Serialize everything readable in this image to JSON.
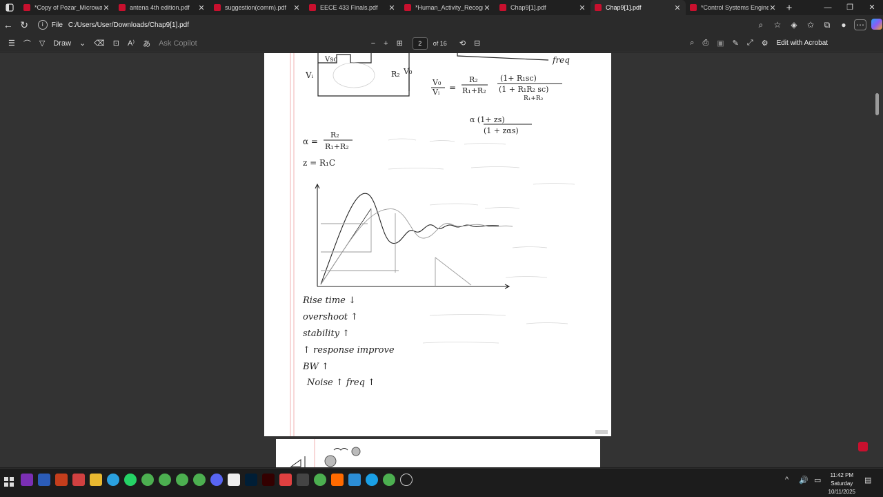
{
  "browser": {
    "tabs": [
      {
        "title": "*Copy of Pozar_Microwave",
        "active": false
      },
      {
        "title": "antena 4th edition.pdf",
        "active": false
      },
      {
        "title": "suggestion(comm).pdf",
        "active": false
      },
      {
        "title": "EECE 433 Finals.pdf",
        "active": false
      },
      {
        "title": "*Human_Activity_Recogniti",
        "active": false
      },
      {
        "title": "Chap9[1].pdf",
        "active": false
      },
      {
        "title": "Chap9[1].pdf",
        "active": true
      },
      {
        "title": "*Control Systems Engineeri",
        "active": false
      }
    ],
    "address": {
      "label": "File",
      "url": "C:/Users/User/Downloads/Chap9[1].pdf"
    }
  },
  "pdf_toolbar": {
    "draw_label": "Draw",
    "ask_copilot": "Ask Copilot",
    "page_current": "2",
    "page_total": "of 16",
    "edit_acrobat": "Edit with Acrobat"
  },
  "notes": {
    "vi": "Vᵢ",
    "vo": "V₀",
    "r2": "R₂",
    "c_box": "Vsc",
    "tf_lhs_num": "V₀",
    "tf_lhs_den": "Vᵢ",
    "tf_eq": "=",
    "tf_r_num": "R₂",
    "tf_r_den": "R₁+R₂",
    "tf_big_num": "(1+ R₁sc)",
    "tf_big_den": "(1 + R₁R₂ sc)",
    "tf_small_den": "R₁+R₂",
    "alpha_tf": "α (1+ zs)",
    "alpha_tf_den": "(1 + zαs)",
    "alpha_lhs": "α =",
    "alpha_num": "R₂",
    "alpha_den": "R₁+R₂",
    "tau_line": "z = R₁C",
    "freq": "freq",
    "list": [
      "Rise time ↓",
      "overshoot ↑",
      "stability ↑",
      "↑ response improve",
      "BW ↑",
      "Noise ↑   freq ↑"
    ]
  },
  "taskbar": {
    "time": "11:42 PM",
    "day": "Saturday",
    "date": "10/11/2025"
  }
}
